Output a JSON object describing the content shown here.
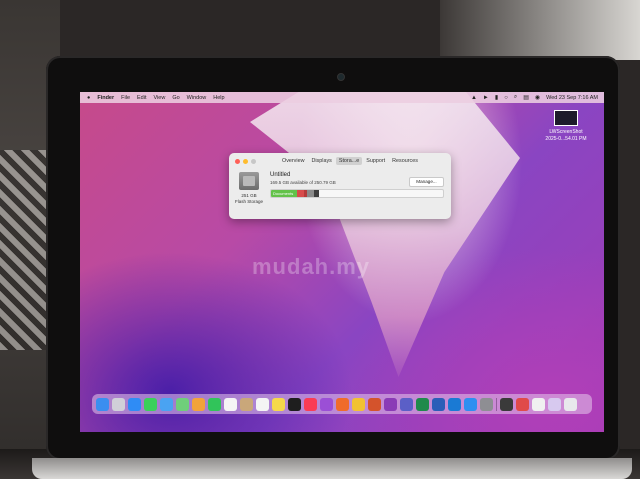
{
  "menubar": {
    "apple": "",
    "items": [
      "Finder",
      "File",
      "Edit",
      "View",
      "Go",
      "Window",
      "Help"
    ],
    "clock": "Wed 23 Sep  7:16 AM"
  },
  "desktop": {
    "file_name_line1": "LWScreenShot",
    "file_name_line2": "2025-0...54.01 PM"
  },
  "about_window": {
    "tabs": [
      "Overview",
      "Displays",
      "Stora...e",
      "Support",
      "Resources"
    ],
    "active_tab": 2,
    "volume_name": "Untitled",
    "available_text": "169.5 GB available of 250.79 GB",
    "manage_label": "Manage...",
    "disk_capacity": "251 GB",
    "disk_type": "Flash Storage",
    "storage_bar": {
      "documents_label": "Documents",
      "segments_fraction": {
        "documents": 0.15,
        "red1": 0.04,
        "red2": 0.02,
        "gray": 0.04,
        "dark": 0.03
      }
    }
  },
  "watermark": "mudah.my",
  "dock": {
    "icons": [
      {
        "name": "finder-icon",
        "color": "#3a8ef0"
      },
      {
        "name": "launchpad-icon",
        "color": "#d0d0d8"
      },
      {
        "name": "safari-icon",
        "color": "#2f8cf5"
      },
      {
        "name": "messages-icon",
        "color": "#3ad15a"
      },
      {
        "name": "mail-icon",
        "color": "#4aa3f2"
      },
      {
        "name": "maps-icon",
        "color": "#6fcf7a"
      },
      {
        "name": "photos-icon",
        "color": "#f2a33a"
      },
      {
        "name": "facetime-icon",
        "color": "#31c45a"
      },
      {
        "name": "calendar-icon",
        "color": "#f5f5f5"
      },
      {
        "name": "contacts-icon",
        "color": "#c9a77a"
      },
      {
        "name": "reminders-icon",
        "color": "#f4f4f4"
      },
      {
        "name": "notes-icon",
        "color": "#f5d94a"
      },
      {
        "name": "appletv-icon",
        "color": "#1e1e1e"
      },
      {
        "name": "music-icon",
        "color": "#fa3c55"
      },
      {
        "name": "podcasts-icon",
        "color": "#9b4fd6"
      },
      {
        "name": "firefox-icon",
        "color": "#f06b2a"
      },
      {
        "name": "chrome-icon",
        "color": "#f2c232"
      },
      {
        "name": "powerpoint-icon",
        "color": "#d4532c"
      },
      {
        "name": "onenote-icon",
        "color": "#8a3bb6"
      },
      {
        "name": "teams-icon",
        "color": "#5b5fc7"
      },
      {
        "name": "excel-icon",
        "color": "#1f8a4c"
      },
      {
        "name": "word-icon",
        "color": "#2b5eb8"
      },
      {
        "name": "outlook-icon",
        "color": "#1a7ad4"
      },
      {
        "name": "appstore-icon",
        "color": "#2d8ff0"
      },
      {
        "name": "settings-icon",
        "color": "#8e8e93"
      },
      {
        "name": "sep"
      },
      {
        "name": "screenshot-app-icon",
        "color": "#3a3a3a"
      },
      {
        "name": "preview-icon",
        "color": "#e04a4a"
      },
      {
        "name": "utility-icon",
        "color": "#f0f0f0"
      },
      {
        "name": "folder-icon",
        "color": "#d7c9ef"
      },
      {
        "name": "trash-icon",
        "color": "#e8e8ec"
      }
    ]
  }
}
